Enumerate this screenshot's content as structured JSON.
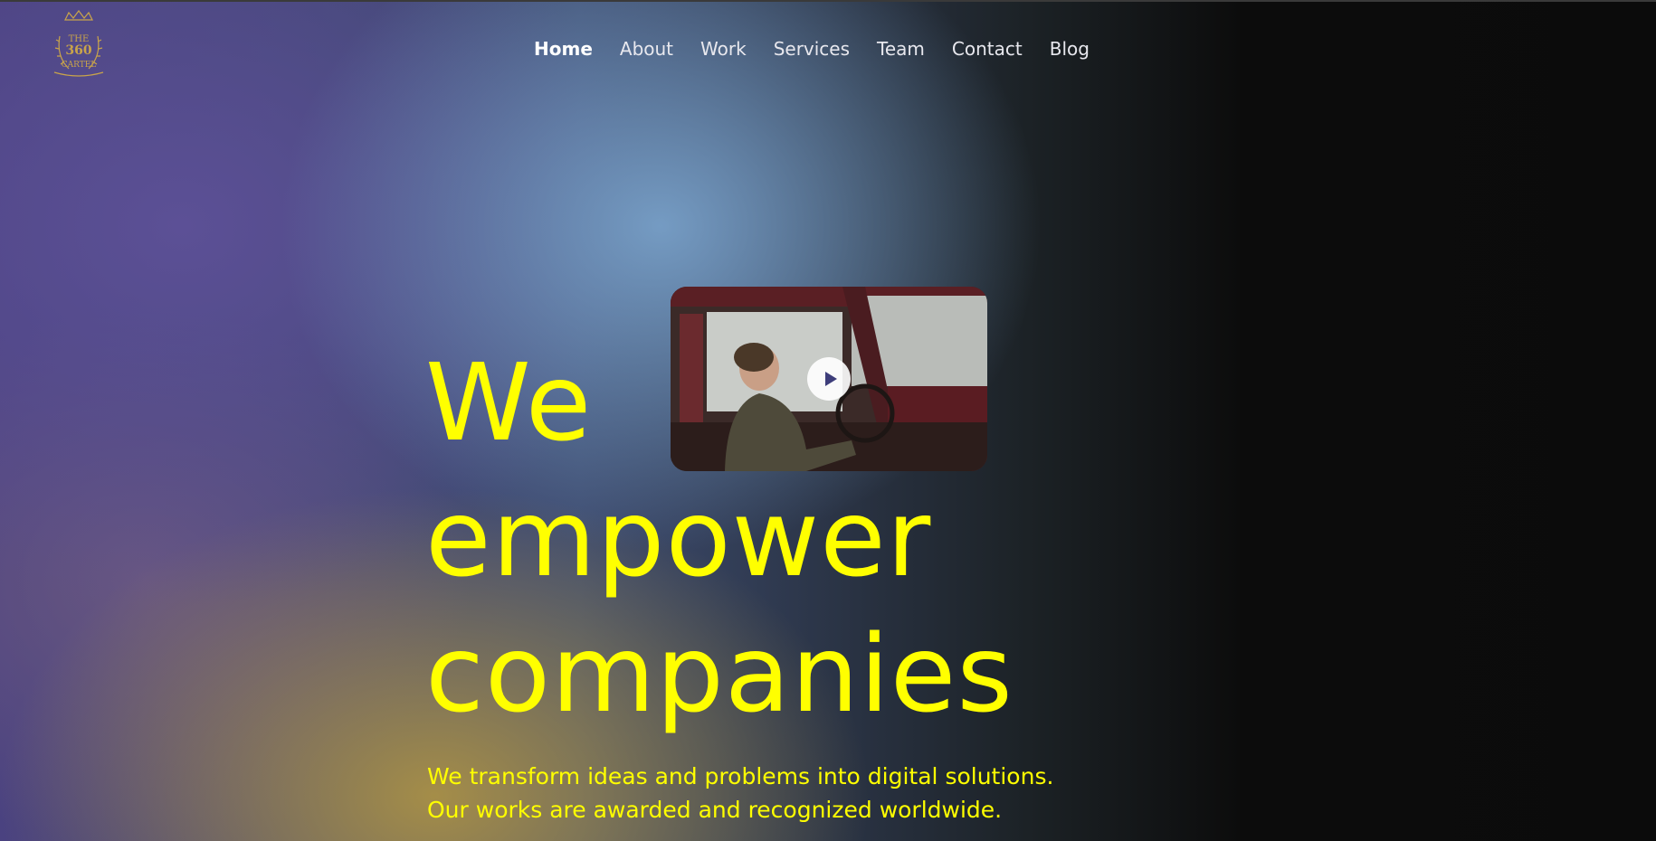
{
  "brand": {
    "logo_line1": "THE",
    "logo_line2": "360",
    "logo_line3": "CARTEL",
    "logo_color": "#c9a44a"
  },
  "nav": {
    "items": [
      {
        "label": "Home",
        "active": true
      },
      {
        "label": "About",
        "active": false
      },
      {
        "label": "Work",
        "active": false
      },
      {
        "label": "Services",
        "active": false
      },
      {
        "label": "Team",
        "active": false
      },
      {
        "label": "Contact",
        "active": false
      },
      {
        "label": "Blog",
        "active": false
      }
    ]
  },
  "hero": {
    "line1": "We",
    "line2": "empower",
    "line3": "companies",
    "sub_line1": "We transform ideas and problems into digital solutions.",
    "sub_line2": "Our works are awarded and recognized worldwide.",
    "accent_color": "#ffff00"
  },
  "video": {
    "play_icon": "play-icon"
  }
}
